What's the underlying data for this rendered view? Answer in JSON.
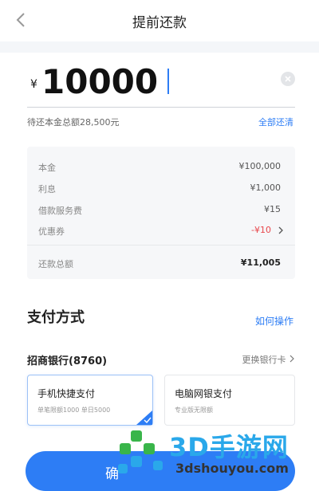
{
  "header": {
    "title": "提前还款"
  },
  "amount": {
    "currency": "¥",
    "value": "10000"
  },
  "summary": {
    "due_text": "待还本金总额28,500元",
    "pay_all_label": "全部还清"
  },
  "details": [
    {
      "label": "本金",
      "value": "¥100,000"
    },
    {
      "label": "利息",
      "value": "¥1,000"
    },
    {
      "label": "借款服务费",
      "value": "¥15"
    },
    {
      "label": "优惠券",
      "value": "-¥10"
    },
    {
      "label": "还款总额",
      "value": "¥11,005"
    }
  ],
  "payment": {
    "title": "支付方式",
    "how_label": "如何操作",
    "bank": "招商银行(8760)",
    "change_label": "更换银行卡",
    "options": [
      {
        "name": "手机快捷支付",
        "desc": "单笔限额1000 单日5000"
      },
      {
        "name": "电脑网银支付",
        "desc": "专业版无限额"
      }
    ]
  },
  "confirm_label": "确",
  "watermark": {
    "brand": "3D手游网",
    "url": "3dshouyou.com"
  },
  "colors": {
    "accent": "#2d7df5",
    "danger": "#e8474c",
    "watermark": "#2aa8ea"
  },
  "icons": [
    "back-arrow-icon",
    "clear-icon",
    "chevron-right-icon",
    "check-corner-icon"
  ]
}
